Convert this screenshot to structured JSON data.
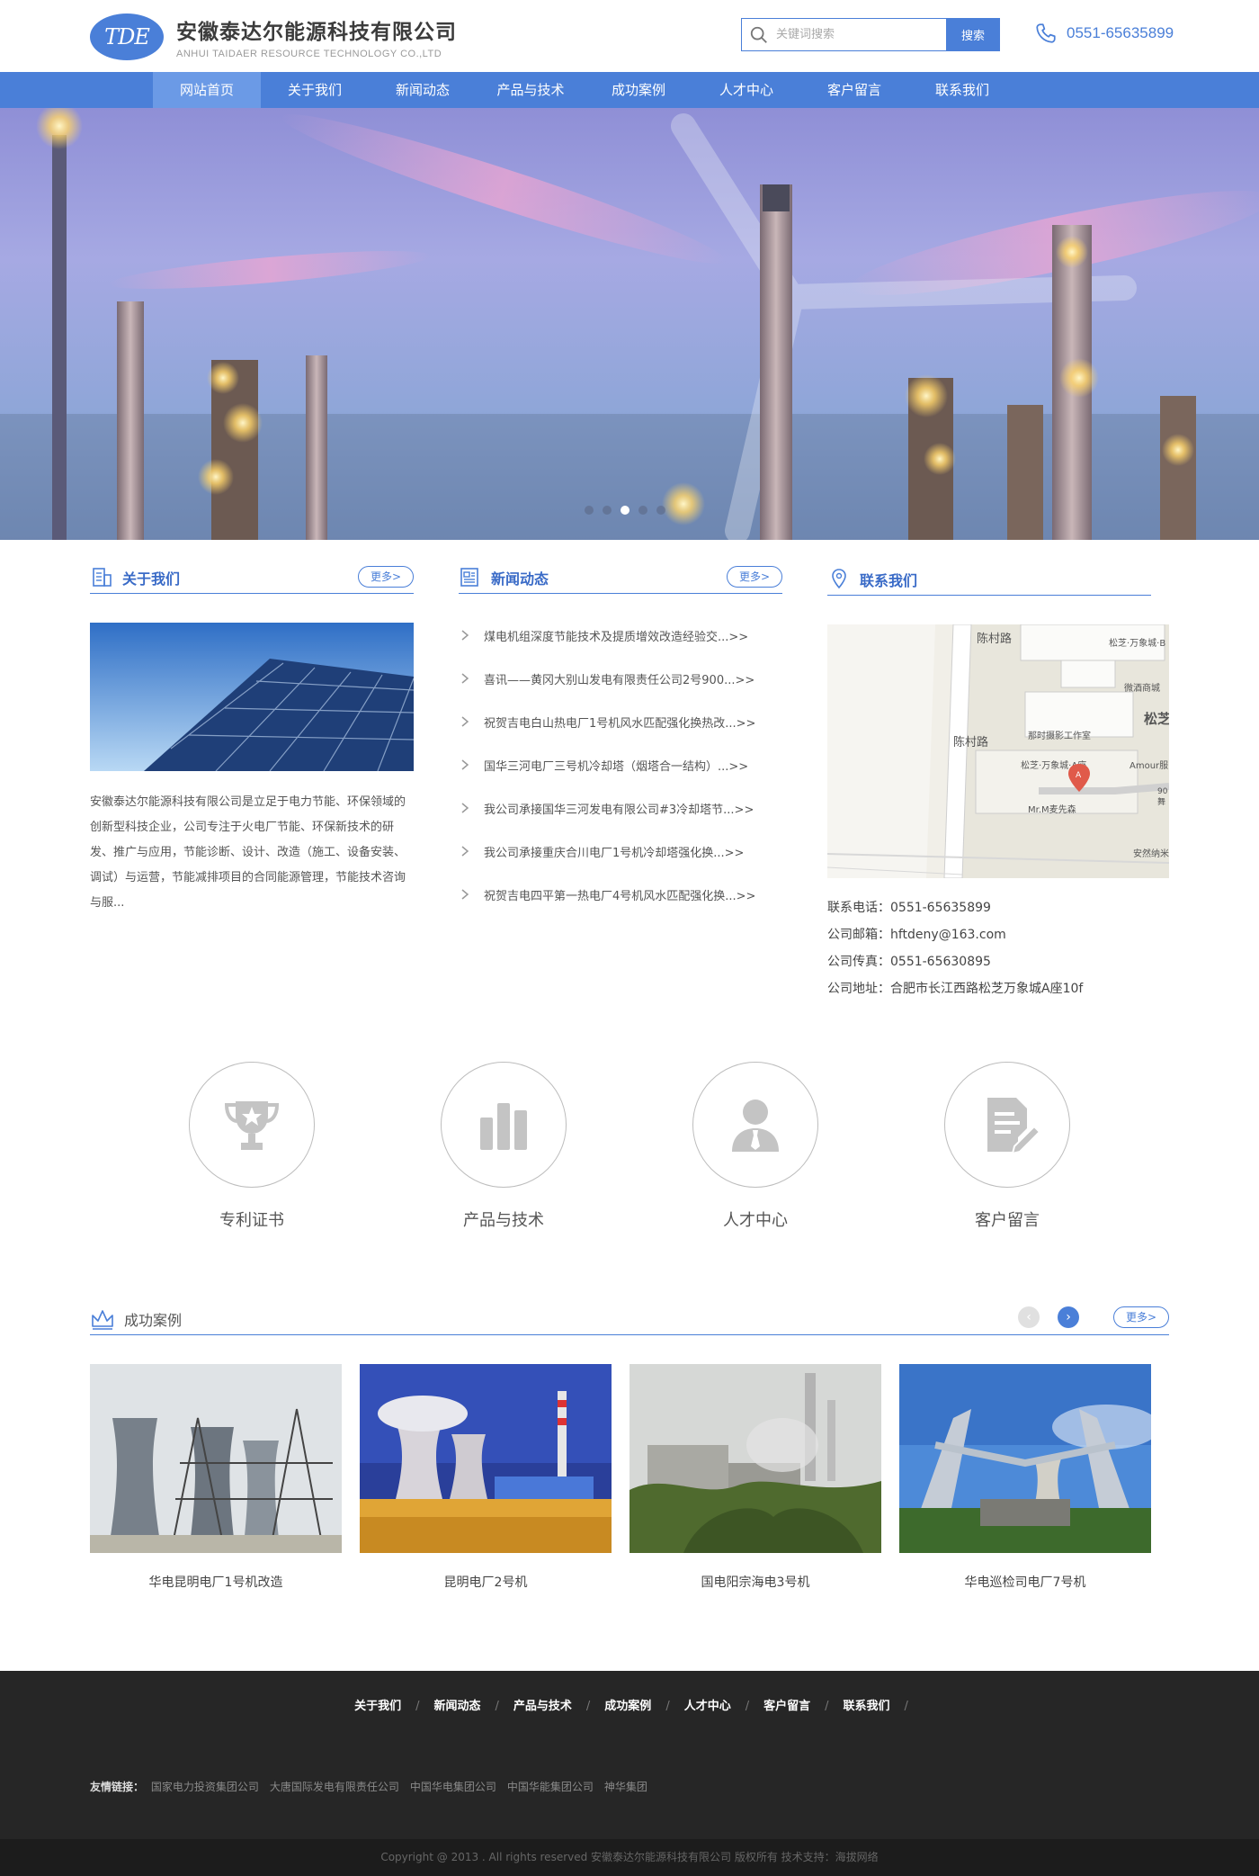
{
  "header": {
    "logo_mark": "TDE",
    "logo_cn": "安徽泰达尔能源科技有限公司",
    "logo_en": "ANHUI TAIDAER RESOURCE TECHNOLOGY CO.,LTD",
    "search_placeholder": "关键词搜索",
    "search_button": "搜索",
    "phone": "0551-65635899"
  },
  "nav": {
    "items": [
      "网站首页",
      "关于我们",
      "新闻动态",
      "产品与技术",
      "成功案例",
      "人才中心",
      "客户留言",
      "联系我们"
    ],
    "active_index": 0
  },
  "banner": {
    "slide_count": 5,
    "active_slide": 3
  },
  "about": {
    "title": "关于我们",
    "more": "更多>",
    "text": "安徽泰达尔能源科技有限公司是立足于电力节能、环保领域的创新型科技企业，公司专注于火电厂节能、环保新技术的研发、推广与应用，节能诊断、设计、改造（施工、设备安装、调试）与运营，节能减排项目的合同能源管理，节能技术咨询与服..."
  },
  "news": {
    "title": "新闻动态",
    "more": "更多>",
    "items": [
      "煤电机组深度节能技术及提质增效改造经验交...>>",
      "喜讯——黄冈大别山发电有限责任公司2号900...>>",
      "祝贺吉电白山热电厂1号机风水匹配强化换热改...>>",
      "国华三河电厂三号机冷却塔（烟塔合一结构）...>>",
      "我公司承接国华三河发电有限公司#3冷却塔节...>>",
      "我公司承接重庆合川电厂1号机冷却塔强化换...>>",
      "祝贺吉电四平第一热电厂4号机风水匹配强化换...>>"
    ]
  },
  "contact": {
    "title": "联系我们",
    "map_labels": {
      "road": "陈村路",
      "square": "松芝",
      "p1": "松芝·万象城·B",
      "p2": "微酒商城",
      "p3": "那时摄影工作室",
      "p4": "松芝·万象城·A座",
      "p5": "Amour服",
      "p6": "Mr.M麦先森",
      "p7": "安然纳米",
      "p8": "90",
      "p9": "舞"
    },
    "items": [
      "联系电话：0551-65635899",
      "公司邮箱：hftdeny@163.com",
      "公司传真：0551-65630895",
      "公司地址：合肥市长江西路松芝万象城A座10f"
    ]
  },
  "features": [
    {
      "label": "专利证书",
      "icon": "trophy-icon"
    },
    {
      "label": "产品与技术",
      "icon": "bar-chart-icon"
    },
    {
      "label": "人才中心",
      "icon": "person-icon"
    },
    {
      "label": "客户留言",
      "icon": "message-edit-icon"
    }
  ],
  "cases": {
    "title": "成功案例",
    "more": "更多>",
    "prev": "‹",
    "next": "›",
    "items": [
      "华电昆明电厂1号机改造",
      "昆明电厂2号机",
      "国电阳宗海电3号机",
      "华电巡检司电厂7号机"
    ]
  },
  "footer": {
    "nav": [
      "关于我们",
      "新闻动态",
      "产品与技术",
      "成功案例",
      "人才中心",
      "客户留言",
      "联系我们"
    ],
    "separator": "/",
    "friend_title": "友情链接：",
    "friend_links": [
      "国家电力投资集团公司",
      "大唐国际发电有限责任公司",
      "中国华电集团公司",
      "中国华能集团公司",
      "神华集团"
    ],
    "copyright": "Copyright @ 2013 . All rights reserved 安徽泰达尔能源科技有限公司 版权所有 技术支持：海拔网络"
  },
  "colors": {
    "brand": "#4a7fd8",
    "footer_bg": "#262626"
  }
}
